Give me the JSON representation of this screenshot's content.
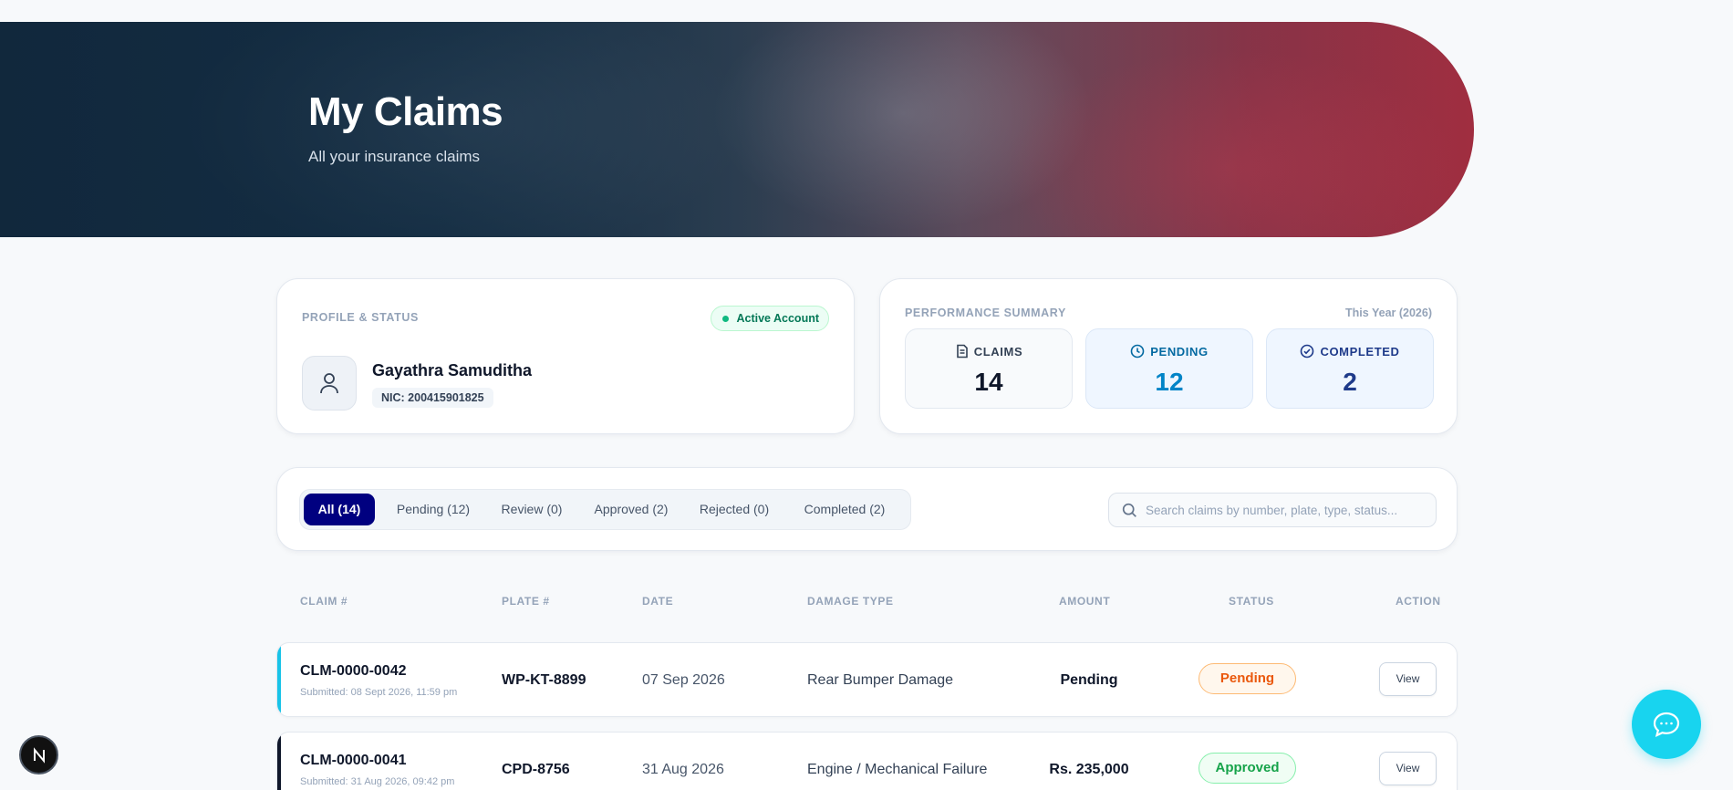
{
  "hero": {
    "title": "My Claims",
    "subtitle": "All your insurance claims"
  },
  "profile": {
    "section_label": "PROFILE & STATUS",
    "status_badge": "Active Account",
    "name": "Gayathra Samuditha",
    "nic": "NIC: 200415901825"
  },
  "performance": {
    "section_label": "PERFORMANCE SUMMARY",
    "period": "This Year (2026)",
    "stats": [
      {
        "label": "CLAIMS",
        "value": "14",
        "icon": "document-icon"
      },
      {
        "label": "PENDING",
        "value": "12",
        "icon": "clock-icon"
      },
      {
        "label": "COMPLETED",
        "value": "2",
        "icon": "check-circle-icon"
      }
    ]
  },
  "filters": {
    "tabs": [
      {
        "label": "All (14)",
        "active": true
      },
      {
        "label": "Pending (12)",
        "active": false
      },
      {
        "label": "Review (0)",
        "active": false
      },
      {
        "label": "Approved (2)",
        "active": false
      },
      {
        "label": "Rejected (0)",
        "active": false
      },
      {
        "label": "Completed (2)",
        "active": false
      }
    ],
    "search_placeholder": "Search claims by number, plate, type, status...",
    "search_value": ""
  },
  "table": {
    "headers": [
      "CLAIM #",
      "PLATE #",
      "DATE",
      "DAMAGE TYPE",
      "AMOUNT",
      "STATUS",
      "ACTION"
    ],
    "rows": [
      {
        "claim": "CLM-0000-0042",
        "submitted": "Submitted: 08 Sept 2026, 11:59 pm",
        "plate": "WP-KT-8899",
        "date": "07 Sep 2026",
        "damage": "Rear Bumper Damage",
        "amount": "Pending",
        "status": "Pending",
        "action": "View",
        "accent": "#18c3e8"
      },
      {
        "claim": "CLM-0000-0041",
        "submitted": "Submitted: 31 Aug 2026, 09:42 pm",
        "plate": "CPD-8756",
        "date": "31 Aug 2026",
        "damage": "Engine / Mechanical Failure",
        "amount": "Rs. 235,000",
        "status": "Approved",
        "action": "View",
        "accent": "#0f172a"
      }
    ]
  },
  "floating": {
    "left_badge": "N",
    "chat_icon": "chat-bubble-icon"
  },
  "colors": {
    "primary": "#000080",
    "chat": "#18d4ef",
    "pending": "#ea580c",
    "approved": "#16a34a"
  }
}
